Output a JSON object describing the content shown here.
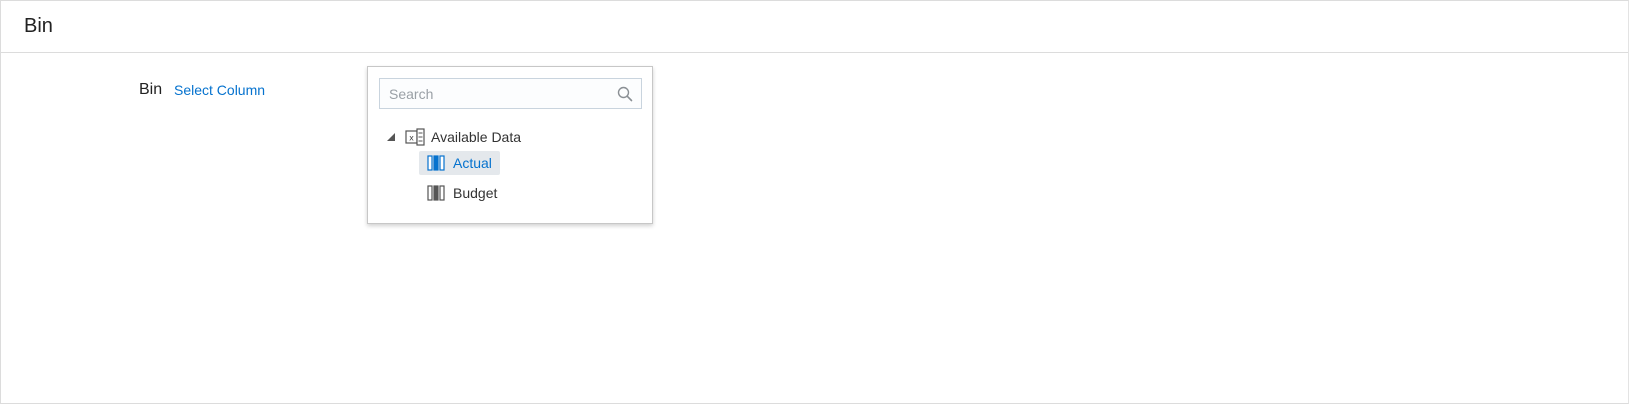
{
  "header": {
    "title": "Bin"
  },
  "form": {
    "field_label": "Bin",
    "select_link_label": "Select Column"
  },
  "popup": {
    "search": {
      "value": "",
      "placeholder": "Search"
    },
    "tree": {
      "root": {
        "label": "Available Data",
        "expanded": true,
        "icon": "dataset-icon"
      },
      "items": [
        {
          "label": "Actual",
          "icon": "column-icon",
          "selected": true
        },
        {
          "label": "Budget",
          "icon": "column-icon",
          "selected": false
        }
      ]
    }
  },
  "colors": {
    "accent": "#0572ce",
    "selected_bg": "#e4e8ec",
    "border": "#dcdcdc"
  }
}
